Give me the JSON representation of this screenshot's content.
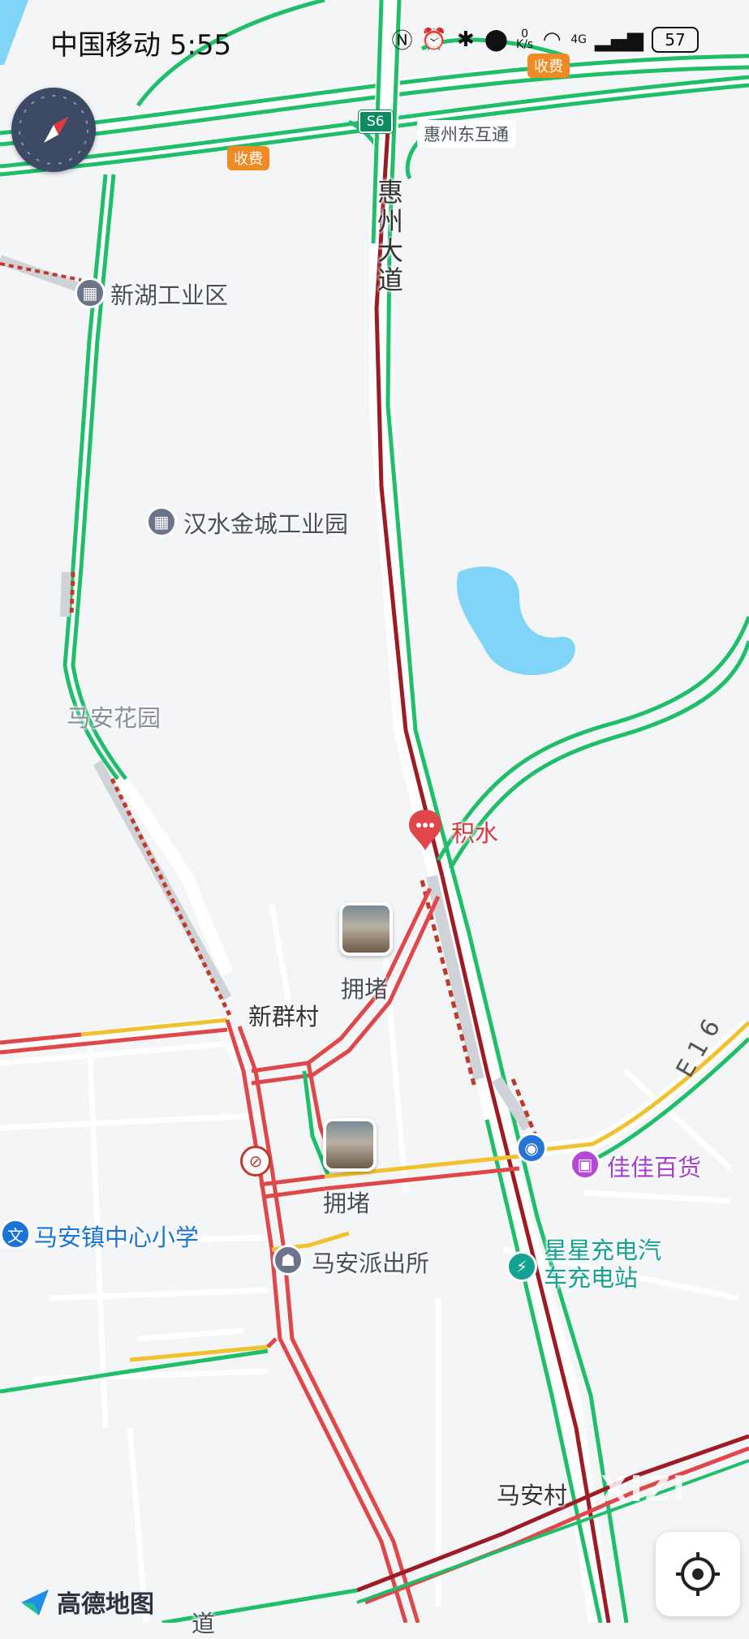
{
  "status_bar": {
    "carrier": "中国移动",
    "time": "5:55",
    "net_speed_value": "0",
    "net_speed_unit": "K/s",
    "network_type": "4G",
    "battery": "57",
    "icons": [
      "nfc-icon",
      "alarm-icon",
      "bluetooth-icon",
      "location-icon",
      "wifi-icon",
      "signal-icon"
    ]
  },
  "map": {
    "toll_labels": [
      "收费",
      "收费"
    ],
    "highway_badge": "S6",
    "interchange_name": "惠州东互通",
    "main_road_vertical": "惠州大道",
    "places": {
      "xinhu": "新湖工业区",
      "hanshui": "汉水金城工业园",
      "maan_garden": "马安花园",
      "xinqun": "新群村",
      "jiajia": "佳佳百货",
      "school": "马安镇中心小学",
      "police": "马安派出所",
      "charging": "星星充电汽车充电站",
      "maan_village": "马安村"
    },
    "event_labels": {
      "water": "积水",
      "jam1": "拥堵",
      "jam2": "拥堵"
    },
    "road_code": "E 1 6",
    "bottom_road_fragment": "道",
    "colors": {
      "smooth": "#1fbf6a",
      "slow": "#f2c12e",
      "congested": "#e0474a",
      "severe": "#9e1b24",
      "water": "#7fd4f7",
      "background": "#f4f5f7"
    }
  },
  "branding": {
    "logo_text": "高德地图",
    "watermark": "XIZI"
  }
}
